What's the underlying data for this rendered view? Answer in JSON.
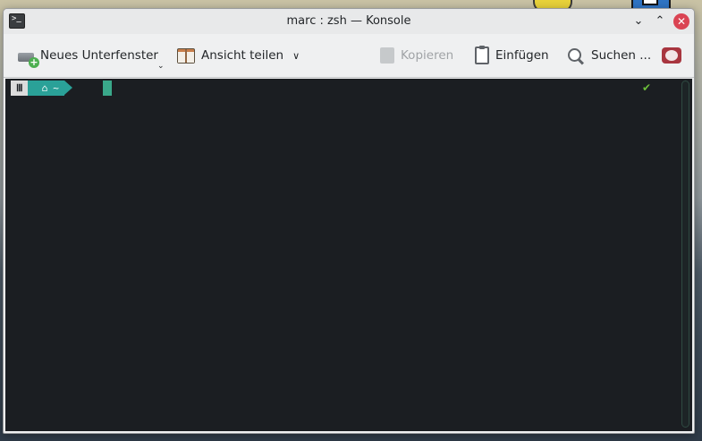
{
  "window": {
    "title": "marc : zsh — Konsole",
    "controls": {
      "minimize": "⌄",
      "maximize": "⌃",
      "close": "✕"
    }
  },
  "toolbar": {
    "new_tab_label": "Neues Unterfenster",
    "split_view_label": "Ansicht teilen",
    "copy_label": "Kopieren",
    "paste_label": "Einfügen",
    "find_label": "Suchen ...",
    "icons": [
      "new-tab-icon",
      "split-view-icon",
      "copy-icon",
      "paste-icon",
      "search-icon",
      "hamburger-menu-icon"
    ]
  },
  "terminal": {
    "prompt_segment_1": "Ⅲ",
    "prompt_home_icon": "⌂",
    "prompt_dir": "~",
    "status_check": "✔"
  },
  "colors": {
    "terminal_bg": "#1b1e22",
    "prompt_teal": "#2aa198",
    "close_button": "#da4453",
    "cursor": "#3aa88a"
  }
}
